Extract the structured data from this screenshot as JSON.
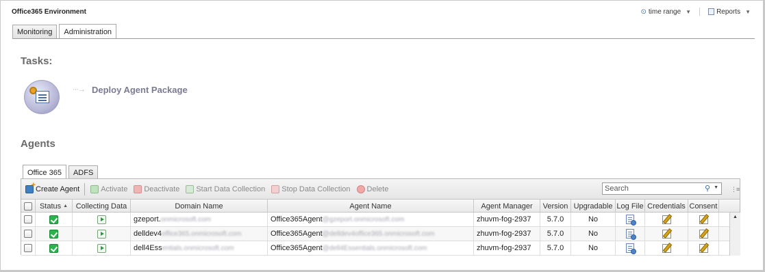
{
  "header": {
    "title": "Office365 Environment",
    "time_range_label": "time range",
    "reports_label": "Reports"
  },
  "main_tabs": [
    {
      "label": "Monitoring",
      "active": false
    },
    {
      "label": "Administration",
      "active": true
    }
  ],
  "tasks": {
    "title": "Tasks:",
    "items": [
      {
        "label": "Deploy Agent Package",
        "arrow": "···→"
      }
    ]
  },
  "agents": {
    "title": "Agents",
    "tabs": [
      {
        "label": "Office 365",
        "active": true
      },
      {
        "label": "ADFS",
        "active": false
      }
    ],
    "toolbar": {
      "create_agent": "Create Agent",
      "activate": "Activate",
      "deactivate": "Deactivate",
      "start_collection": "Start Data Collection",
      "stop_collection": "Stop Data Collection",
      "delete": "Delete",
      "search_placeholder": "Search"
    },
    "columns": [
      "Status",
      "Collecting Data",
      "Domain Name",
      "Agent Name",
      "Agent Manager",
      "Version",
      "Upgradable",
      "Log File",
      "Credentials",
      "Consent"
    ],
    "sort_column": "Status",
    "rows": [
      {
        "domain_prefix": "gzeport.",
        "domain_blurred": "onmicrosoft.com",
        "agent_prefix": "Office365Agent",
        "agent_blurred": "@gzeport.onmicrosoft.com",
        "manager": "zhuvm-fog-2937",
        "version": "5.7.0",
        "upgradable": "No"
      },
      {
        "domain_prefix": "delldev4",
        "domain_blurred": "office365.onmicrosoft.com",
        "agent_prefix": "Office365Agent",
        "agent_blurred": "@delldev4office365.onmicrosoft.com",
        "manager": "zhuvm-fog-2937",
        "version": "5.7.0",
        "upgradable": "No"
      },
      {
        "domain_prefix": "dell4Ess",
        "domain_blurred": "entials.onmicrosoft.com",
        "agent_prefix": "Office365Agent",
        "agent_blurred": "@dell4Essentials.onmicrosoft.com",
        "manager": "zhuvm-fog-2937",
        "version": "5.7.0",
        "upgradable": "No"
      }
    ]
  },
  "colors": {
    "status_ok": "#2bb24c",
    "section_title": "#6a6a6a",
    "task_link": "#7a7a92"
  }
}
